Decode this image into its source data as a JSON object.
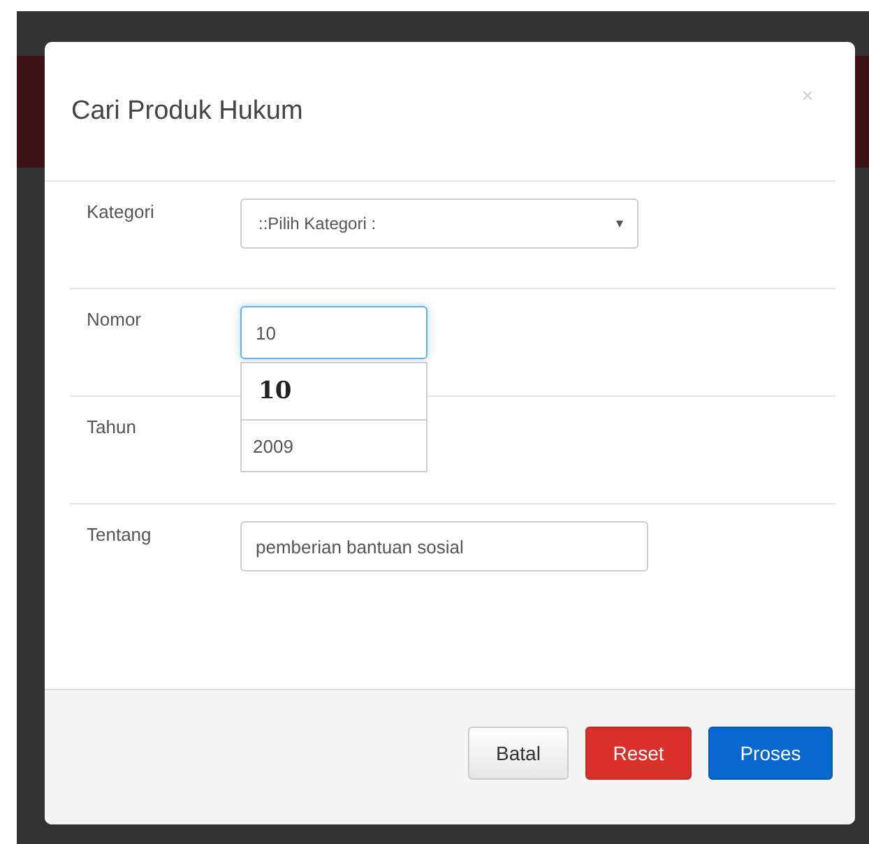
{
  "dialog": {
    "title": "Cari Produk Hukum",
    "close": "×"
  },
  "fields": [
    {
      "label": "Kategori",
      "kind": "select",
      "value": "::Pilih Kategori :",
      "caret": "▾"
    },
    {
      "label": "Nomor",
      "kind": "text",
      "value": "10",
      "focused": true,
      "suggestions": [
        {
          "text": "10",
          "bold": true
        },
        {
          "text": "2009",
          "bold": false
        }
      ]
    },
    {
      "label": "Tahun",
      "kind": "empty"
    },
    {
      "label": "Tentang",
      "kind": "text",
      "value": "pemberian bantuan sosial",
      "focused": false
    }
  ],
  "buttons": [
    {
      "label": "Batal",
      "kind": "default"
    },
    {
      "label": "Reset",
      "kind": "danger"
    },
    {
      "label": "Proses",
      "kind": "primary"
    }
  ]
}
